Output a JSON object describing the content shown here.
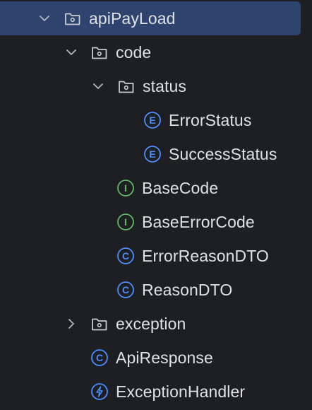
{
  "tree": {
    "root": {
      "label": "apiPayLoad",
      "icon": "package-folder-icon",
      "expanded": true,
      "selected": true
    },
    "code": {
      "label": "code",
      "icon": "package-folder-icon",
      "expanded": true
    },
    "status": {
      "label": "status",
      "icon": "package-folder-icon",
      "expanded": true
    },
    "error_status": {
      "label": "ErrorStatus",
      "icon": "enum-icon",
      "icon_letter": "E"
    },
    "success_status": {
      "label": "SuccessStatus",
      "icon": "enum-icon",
      "icon_letter": "E"
    },
    "base_code": {
      "label": "BaseCode",
      "icon": "interface-icon",
      "icon_letter": "I"
    },
    "base_error_code": {
      "label": "BaseErrorCode",
      "icon": "interface-icon",
      "icon_letter": "I"
    },
    "error_reason_dto": {
      "label": "ErrorReasonDTO",
      "icon": "class-icon",
      "icon_letter": "C"
    },
    "reason_dto": {
      "label": "ReasonDTO",
      "icon": "class-icon",
      "icon_letter": "C"
    },
    "exception": {
      "label": "exception",
      "icon": "package-folder-icon",
      "expanded": false
    },
    "api_response": {
      "label": "ApiResponse",
      "icon": "class-icon",
      "icon_letter": "C"
    },
    "exception_handler": {
      "label": "ExceptionHandler",
      "icon": "advice-icon"
    }
  },
  "colors": {
    "background": "#1e1f22",
    "selection": "#2e436e",
    "text": "#dfe1e5",
    "chevron": "#b4b8bf",
    "enum_class": "#4e8dff",
    "interface": "#5fb865",
    "folder": "#c9ccd1"
  }
}
